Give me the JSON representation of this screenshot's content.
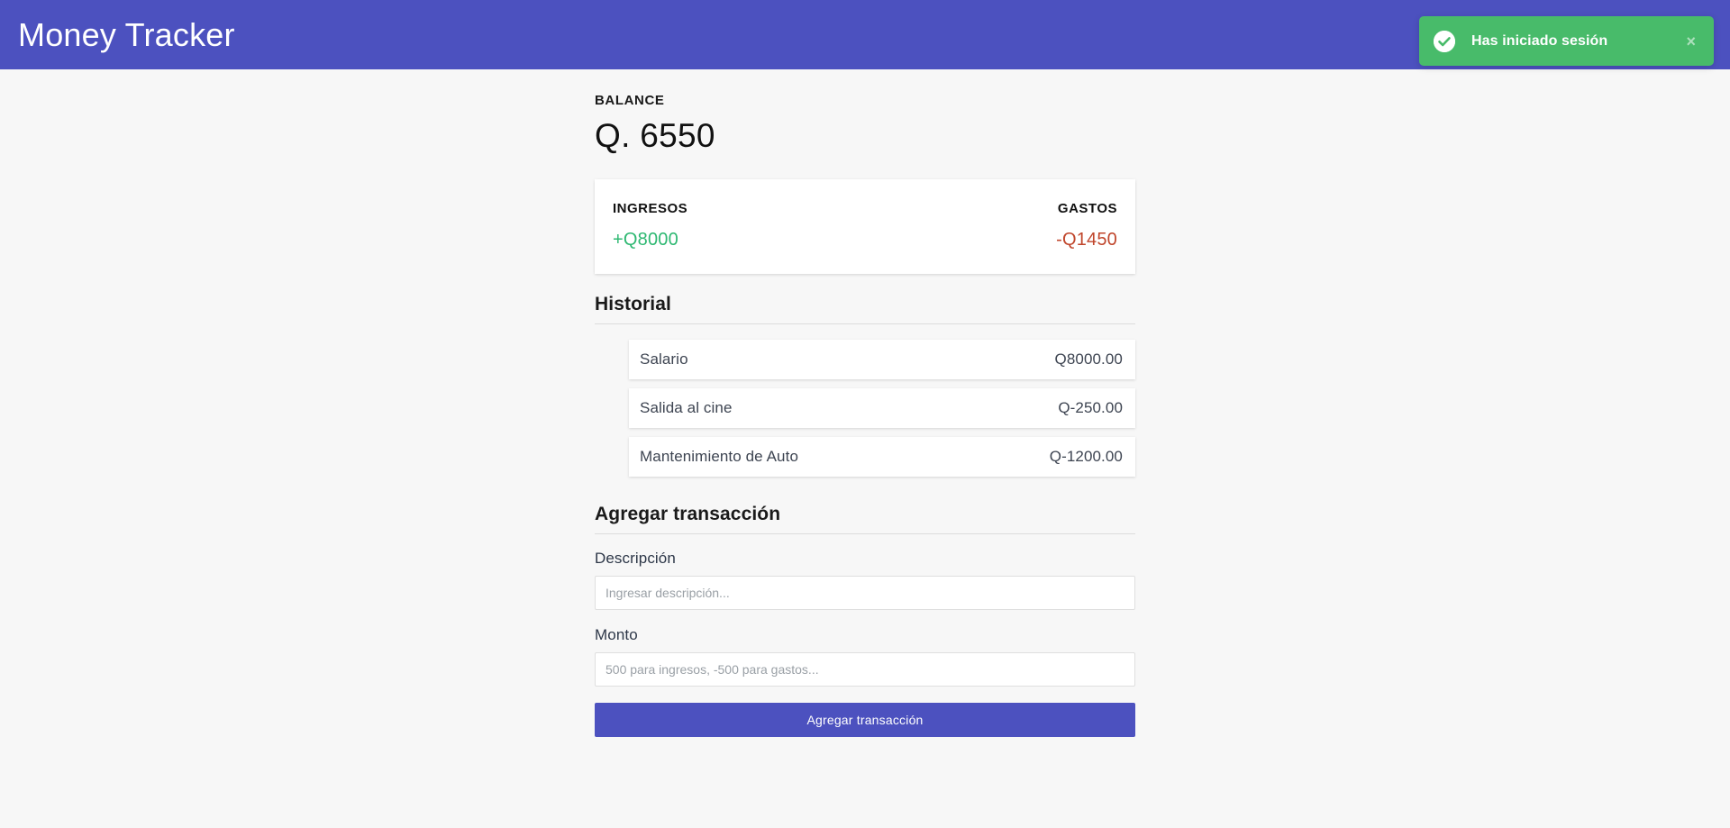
{
  "header": {
    "app_title": "Money Tracker",
    "background_color": "#4c51bf"
  },
  "toast": {
    "message": "Has iniciado sesión",
    "icon": "check-circle-icon",
    "close_icon": "close-icon",
    "close_label": "×",
    "background_color": "#48bb6a"
  },
  "balance": {
    "label": "BALANCE",
    "amount": "Q. 6550"
  },
  "summary": {
    "income_title": "INGRESOS",
    "income_value": "+Q8000",
    "income_color": "#2eb872",
    "expense_title": "GASTOS",
    "expense_value": "-Q1450",
    "expense_color": "#c0462c"
  },
  "history": {
    "heading": "Historial",
    "items": [
      {
        "description": "Salario",
        "amount": "Q8000.00"
      },
      {
        "description": "Salida al cine",
        "amount": "Q-250.00"
      },
      {
        "description": "Mantenimiento de Auto",
        "amount": "Q-1200.00"
      }
    ]
  },
  "form": {
    "heading": "Agregar transacción",
    "description_label": "Descripción",
    "description_placeholder": "Ingresar descripción...",
    "description_value": "",
    "amount_label": "Monto",
    "amount_placeholder": "500 para ingresos, -500 para gastos...",
    "amount_value": "",
    "submit_label": "Agregar transacción"
  }
}
